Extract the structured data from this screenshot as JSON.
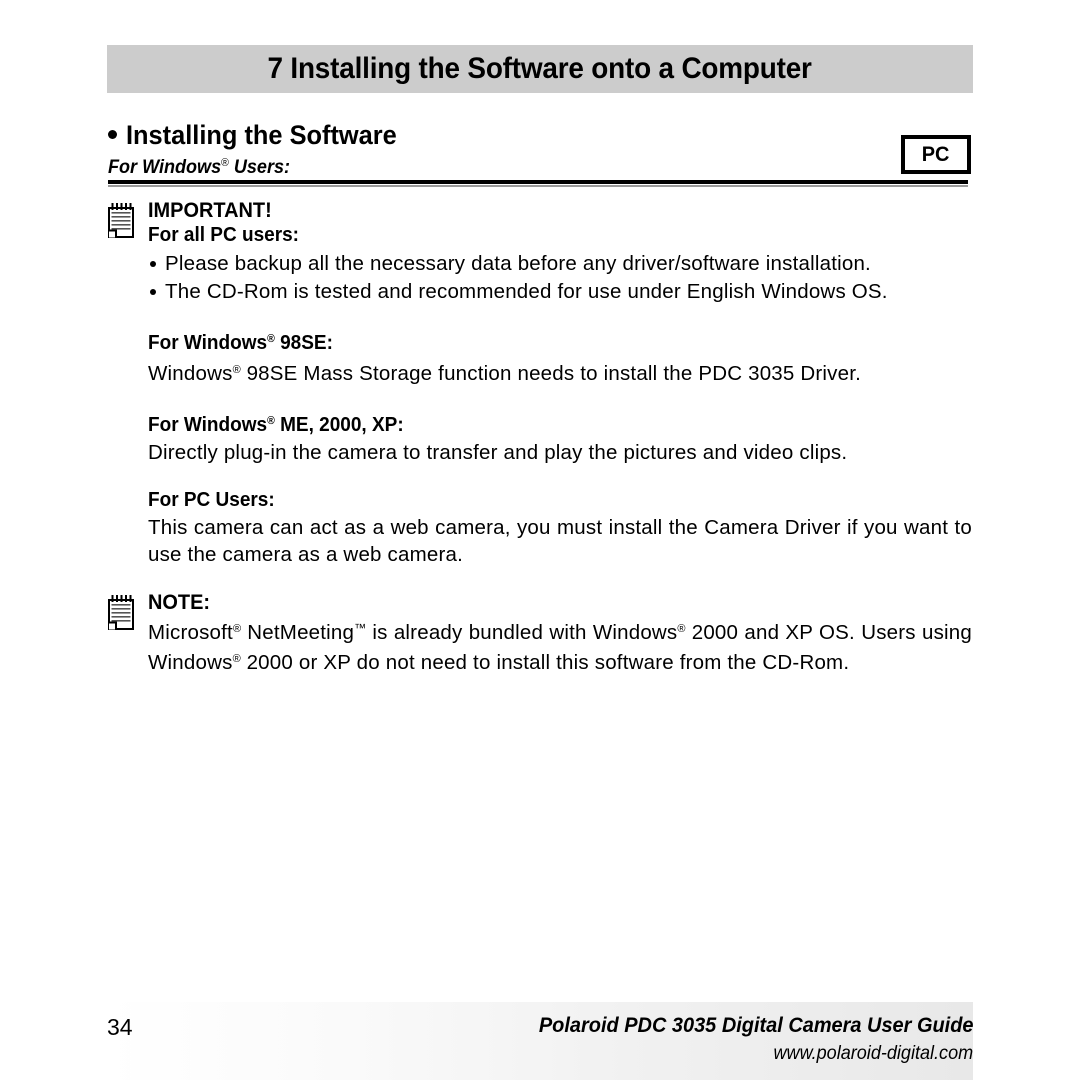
{
  "chapter": {
    "title": "7 Installing the Software onto a Computer"
  },
  "section": {
    "bullet_icon": "bullet-dot",
    "title": "Installing the Software",
    "subtitle_prefix": "For Windows",
    "subtitle_reg": "®",
    "subtitle_suffix": " Users:"
  },
  "platform_badge": {
    "label": "PC"
  },
  "important": {
    "icon": "notepad-icon",
    "title": "IMPORTANT!",
    "subtitle": "For all PC users:",
    "bullets": [
      "Please backup all the necessary data before any driver/software installation.",
      "The CD-Rom is tested and recommended for use under English Windows OS."
    ]
  },
  "win98se": {
    "heading_prefix": "For Windows",
    "heading_reg": "®",
    "heading_suffix": " 98SE:",
    "body_prefix": "Windows",
    "body_reg": "®",
    "body_suffix": " 98SE Mass Storage function needs to install the PDC 3035 Driver."
  },
  "winme": {
    "heading_prefix": "For Windows",
    "heading_reg": "®",
    "heading_suffix": " ME, 2000, XP:",
    "body": "Directly plug-in the camera to transfer and play the pictures and video clips."
  },
  "pcusers": {
    "heading": "For PC Users:",
    "body": "This camera can act as a web camera, you must install the Camera Driver if you want to use the camera as a web camera."
  },
  "note": {
    "icon": "notepad-icon",
    "title": "NOTE:",
    "body_p1": "Microsoft",
    "body_reg1": "®",
    "body_p2": " NetMeeting",
    "body_tm": "™",
    "body_p3": " is already bundled with Windows",
    "body_reg2": "®",
    "body_p4": " 2000 and XP OS. Users using Windows",
    "body_reg3": "®",
    "body_p5": " 2000 or XP do not need to install this software from the CD-Rom."
  },
  "footer": {
    "page_number": "34",
    "guide_title": "Polaroid PDC 3035 Digital Camera User Guide",
    "url": "www.polaroid-digital.com"
  },
  "colors": {
    "chapter_bar_bg": "#cccccc",
    "text": "#000000",
    "rule": "#000000",
    "rule_shadow": "#9a9a9a"
  }
}
